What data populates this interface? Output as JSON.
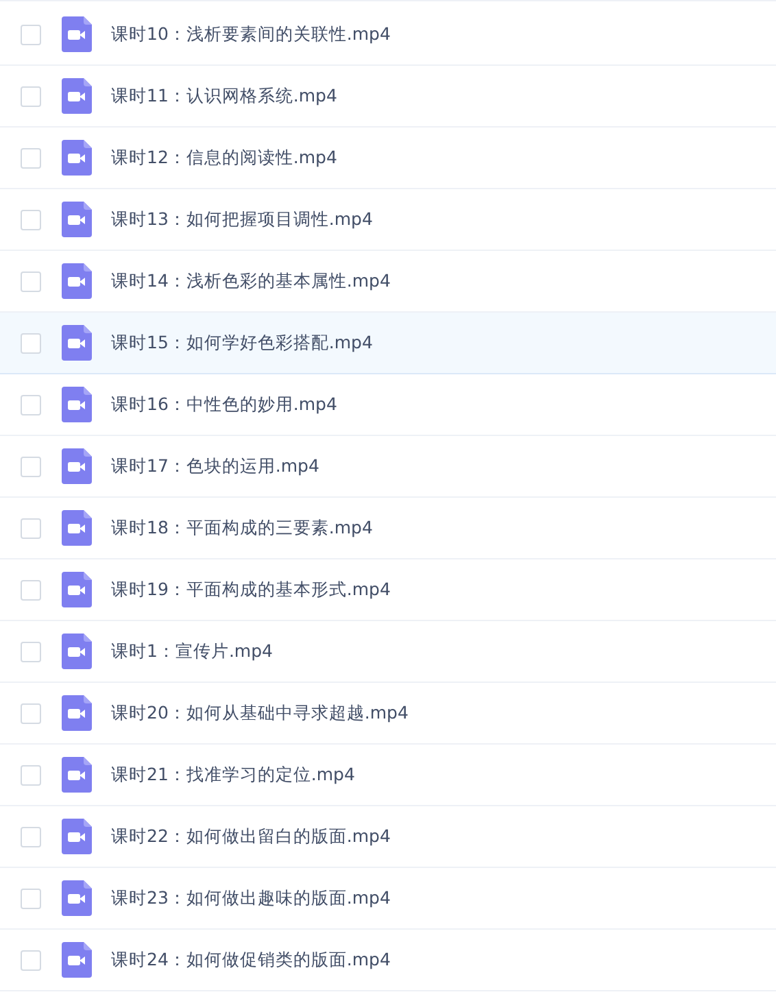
{
  "files": [
    {
      "name": "课时10：浅析要素间的关联性.mp4",
      "checked": false,
      "selected": false
    },
    {
      "name": "课时11：认识网格系统.mp4",
      "checked": false,
      "selected": false
    },
    {
      "name": "课时12：信息的阅读性.mp4",
      "checked": false,
      "selected": false
    },
    {
      "name": "课时13：如何把握项目调性.mp4",
      "checked": false,
      "selected": false
    },
    {
      "name": "课时14：浅析色彩的基本属性.mp4",
      "checked": false,
      "selected": false
    },
    {
      "name": "课时15：如何学好色彩搭配.mp4",
      "checked": false,
      "selected": true
    },
    {
      "name": "课时16：中性色的妙用.mp4",
      "checked": false,
      "selected": false
    },
    {
      "name": "课时17：色块的运用.mp4",
      "checked": false,
      "selected": false
    },
    {
      "name": "课时18：平面构成的三要素.mp4",
      "checked": false,
      "selected": false
    },
    {
      "name": "课时19：平面构成的基本形式.mp4",
      "checked": false,
      "selected": false
    },
    {
      "name": "课时1：宣传片.mp4",
      "checked": false,
      "selected": false
    },
    {
      "name": "课时20：如何从基础中寻求超越.mp4",
      "checked": false,
      "selected": false
    },
    {
      "name": "课时21：找准学习的定位.mp4",
      "checked": false,
      "selected": false
    },
    {
      "name": "课时22：如何做出留白的版面.mp4",
      "checked": false,
      "selected": false
    },
    {
      "name": "课时23：如何做出趣味的版面.mp4",
      "checked": false,
      "selected": false
    },
    {
      "name": "课时24：如何做促销类的版面.mp4",
      "checked": false,
      "selected": false
    }
  ]
}
